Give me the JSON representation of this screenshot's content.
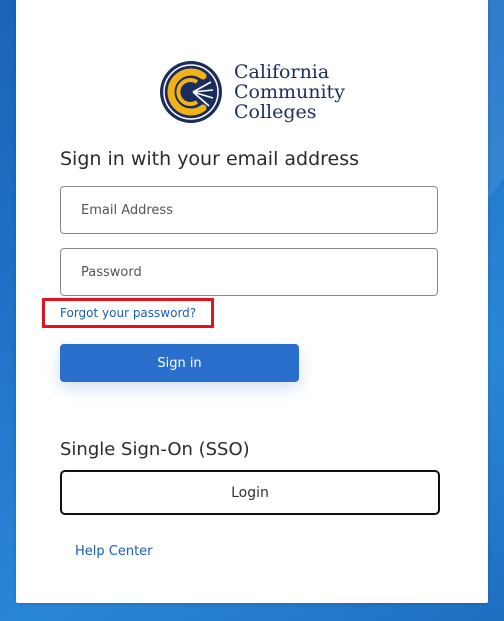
{
  "logo": {
    "line1": "California",
    "line2": "Community",
    "line3": "Colleges",
    "icon": "ccc-seal-icon",
    "colors": {
      "navy": "#1b2d5f",
      "gold": "#f2b316"
    }
  },
  "form": {
    "heading": "Sign in with your email address",
    "email_placeholder": "Email Address",
    "password_placeholder": "Password",
    "forgot_label": "Forgot your password?",
    "signin_label": "Sign in"
  },
  "sso": {
    "heading": "Single Sign-On (SSO)",
    "login_label": "Login"
  },
  "footer": {
    "help_label": "Help Center"
  },
  "colors": {
    "accent": "#2a6fcb",
    "link": "#1a5fb4",
    "highlight": "#e0141e"
  }
}
